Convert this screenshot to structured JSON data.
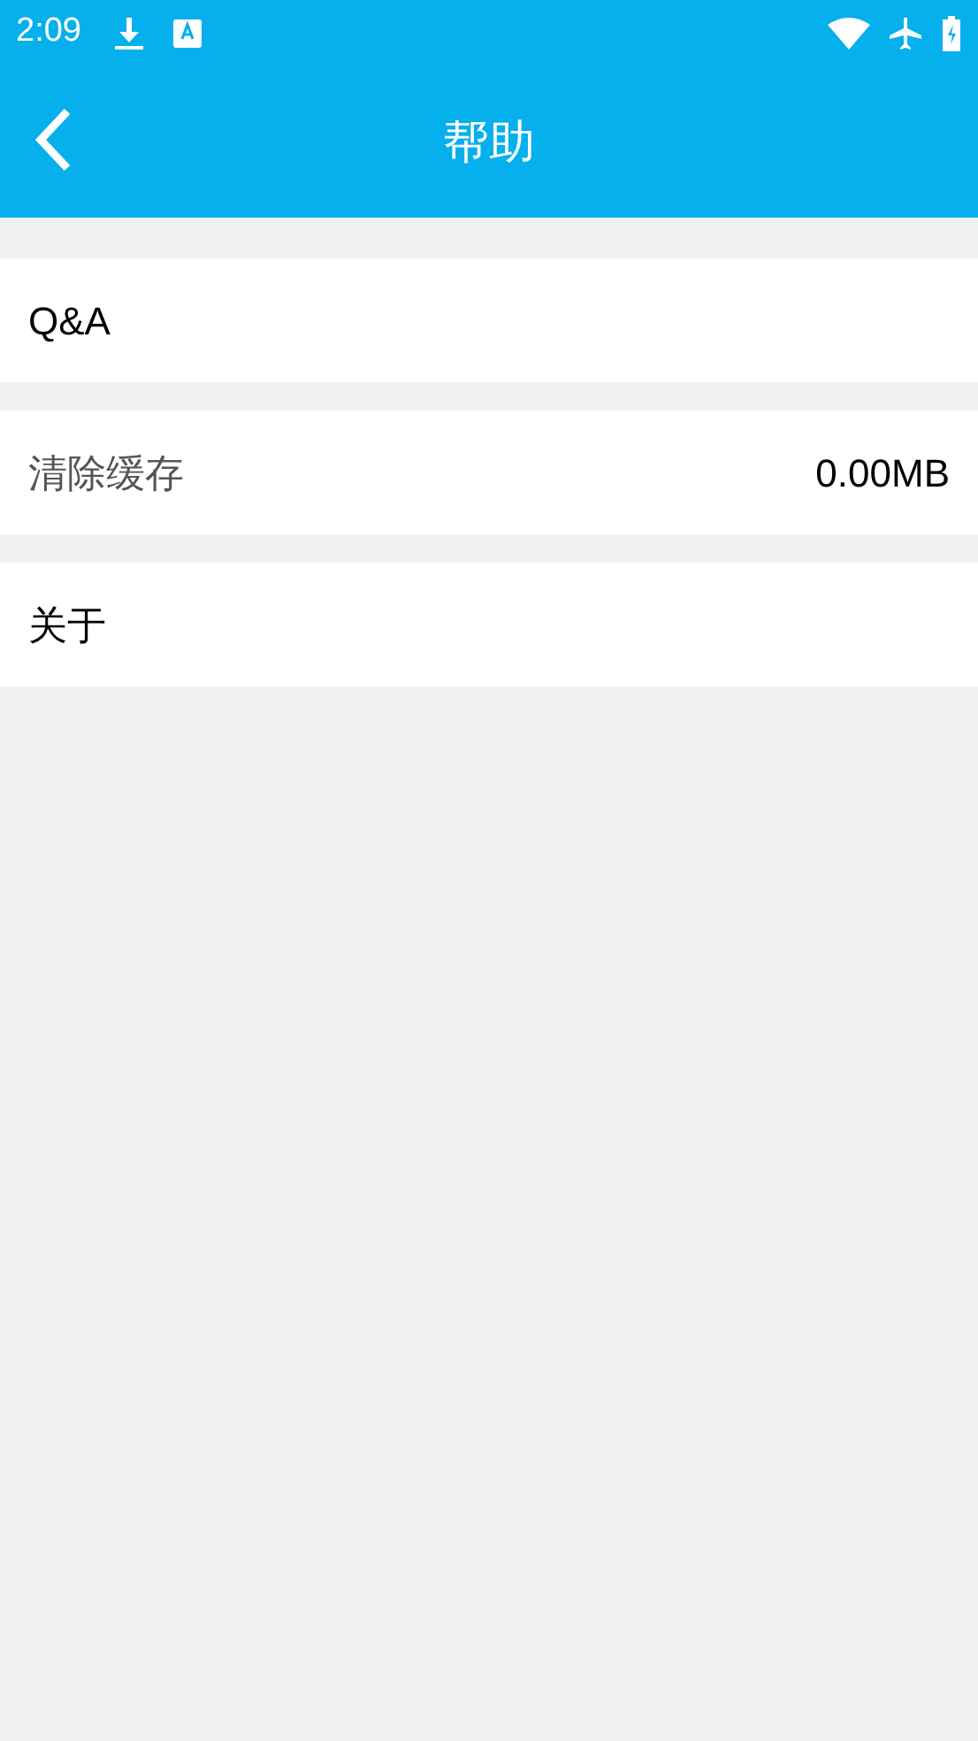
{
  "status_bar": {
    "time": "2:09"
  },
  "toolbar": {
    "title": "帮助"
  },
  "items": [
    {
      "kind": "link",
      "label": "Q&A"
    },
    {
      "kind": "value",
      "label": "清除缓存",
      "value": "0.00MB"
    },
    {
      "kind": "link",
      "label": "关于"
    }
  ]
}
